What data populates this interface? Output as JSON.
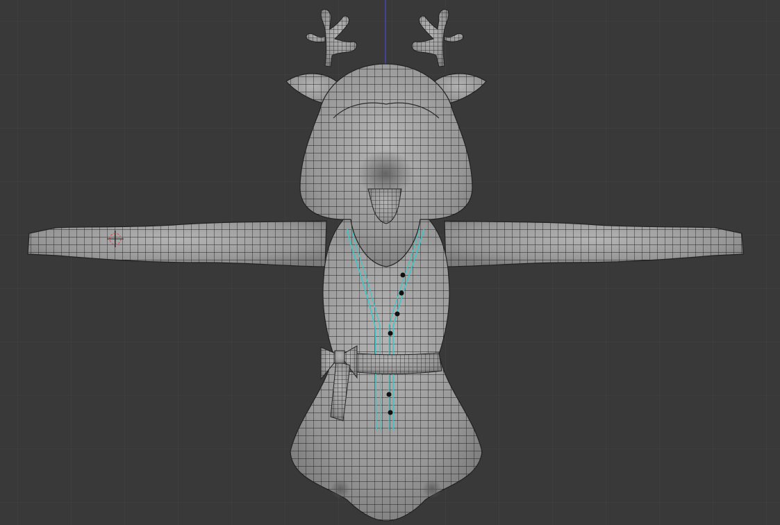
{
  "viewport": {
    "background": "#393939",
    "grid_color": "#444444",
    "axis_z_color": "#4a4ad0",
    "cursor_color": "#d85050"
  },
  "model": {
    "surface_color": "#9a9a9a",
    "wire_color": "#1e1e1e",
    "seam_color": "#3fc7c7",
    "button_color": "#101010"
  }
}
